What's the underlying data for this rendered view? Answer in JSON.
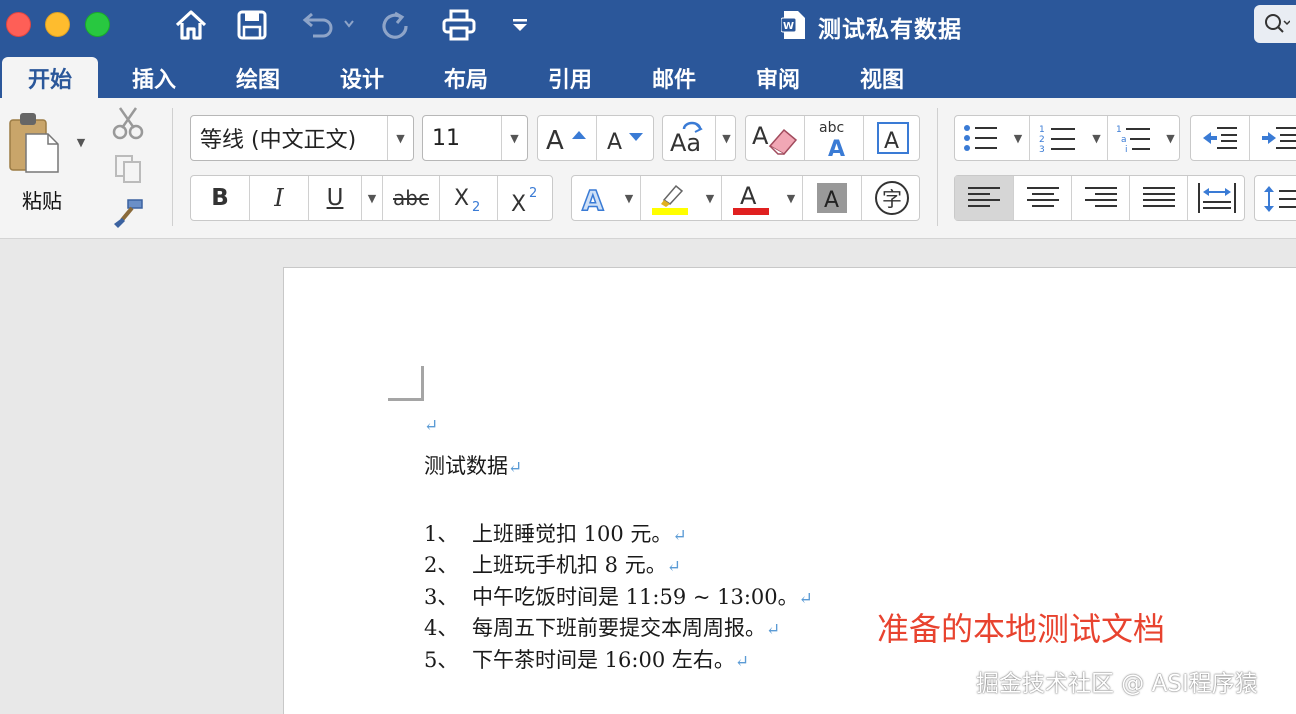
{
  "window": {
    "title": "测试私有数据",
    "quick_access": [
      "home-icon",
      "save-icon",
      "undo-icon",
      "redo-icon",
      "print-icon",
      "customize-icon"
    ]
  },
  "tabs": [
    {
      "label": "开始",
      "active": true
    },
    {
      "label": "插入"
    },
    {
      "label": "绘图"
    },
    {
      "label": "设计"
    },
    {
      "label": "布局"
    },
    {
      "label": "引用"
    },
    {
      "label": "邮件"
    },
    {
      "label": "审阅"
    },
    {
      "label": "视图"
    }
  ],
  "ribbon": {
    "paste_label": "粘贴",
    "font_name": "等线 (中文正文)",
    "font_size": "11"
  },
  "document": {
    "title_line": "测试数据",
    "items": [
      {
        "num": "1、",
        "text": "上班睡觉扣 100 元。"
      },
      {
        "num": "2、",
        "text": "上班玩手机扣 8 元。"
      },
      {
        "num": "3、",
        "text": "中午吃饭时间是 11:59 ~ 13:00。"
      },
      {
        "num": "4、",
        "text": "每周五下班前要提交本周周报。"
      },
      {
        "num": "5、",
        "text": "下午茶时间是 16:00  左右。"
      }
    ],
    "paragraph_mark": "↵"
  },
  "annotation": "准备的本地测试文档",
  "watermark": "掘金技术社区 @ ASI程序猿",
  "colors": {
    "word_blue": "#2b579a",
    "highlight": "#ffff00",
    "font_color": "#e02020",
    "annotation": "#e8432f"
  }
}
